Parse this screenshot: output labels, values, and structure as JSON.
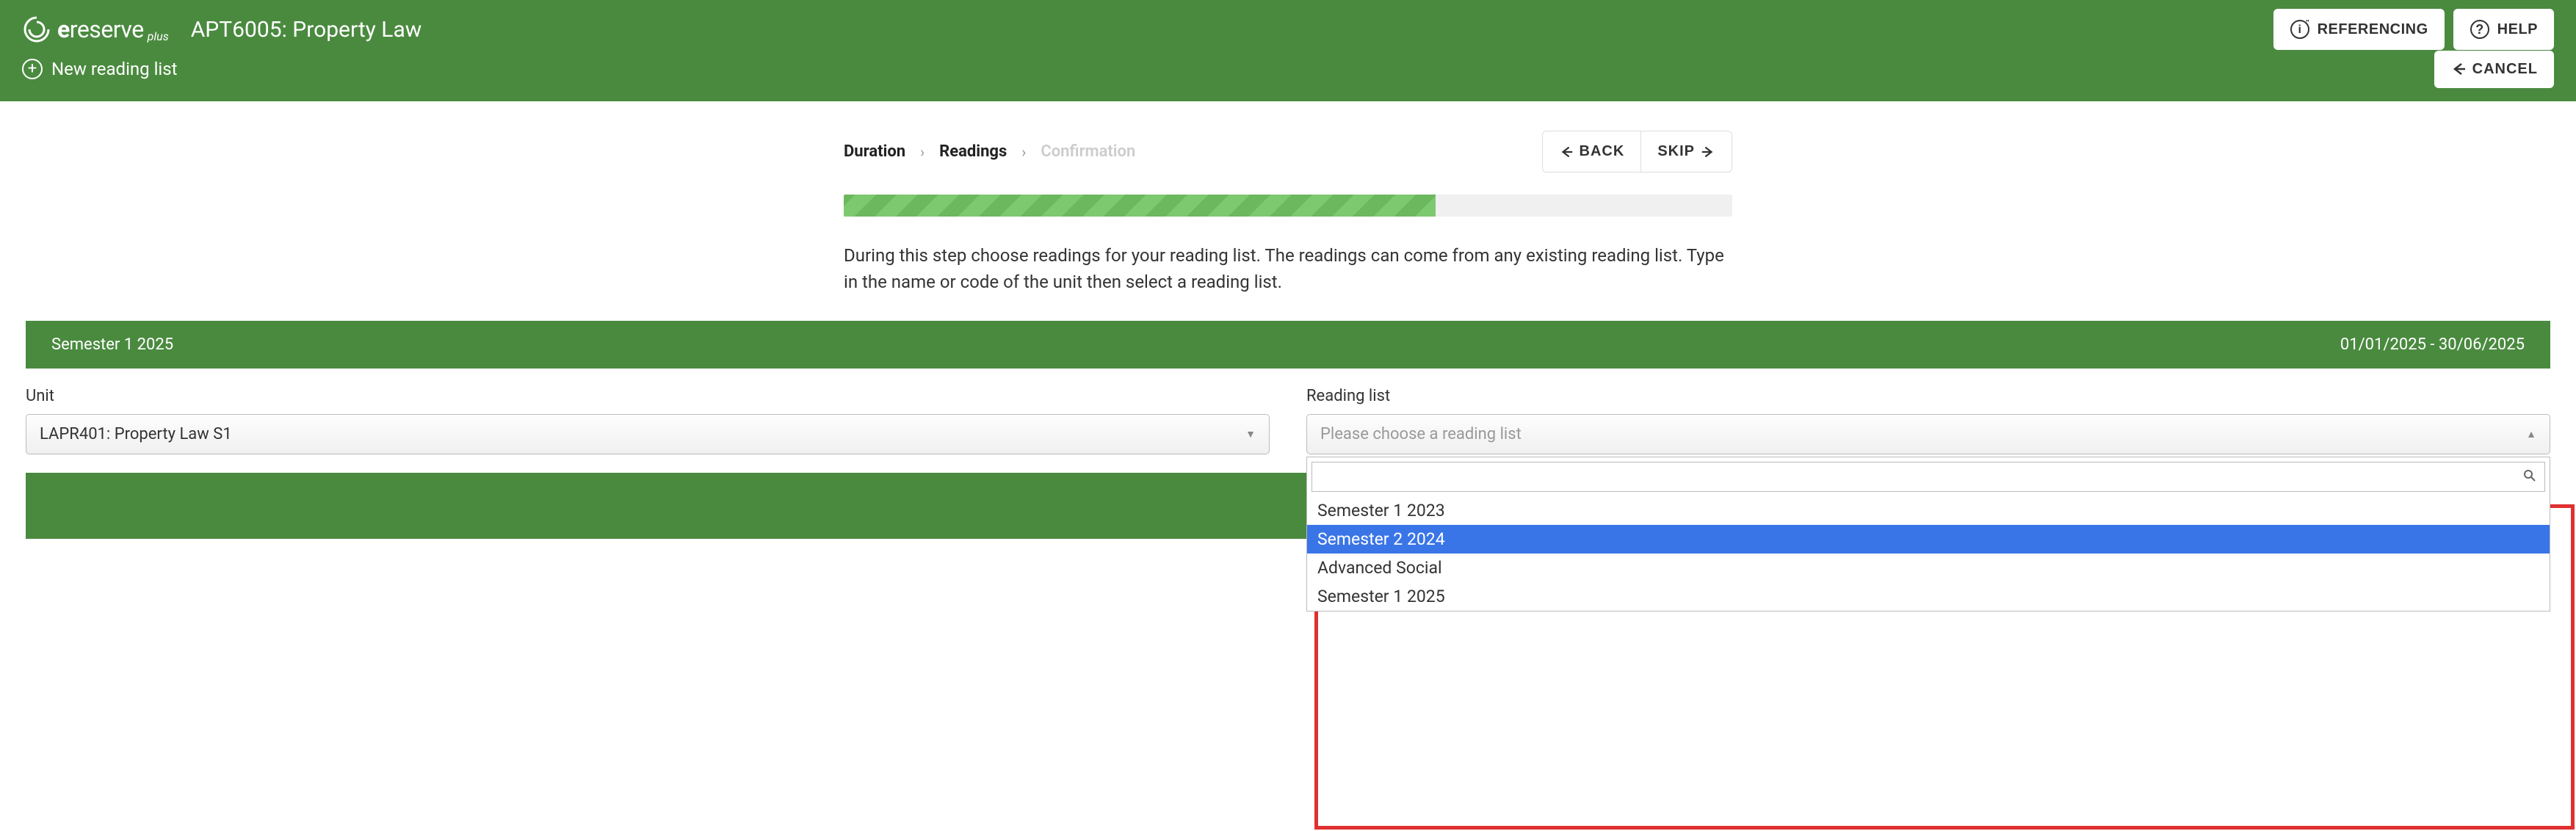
{
  "logo": {
    "brand_prefix": "e",
    "brand_main": "reserve",
    "brand_sub": "plus"
  },
  "page_title": "APT6005: Property Law",
  "header_buttons": {
    "referencing": "REFERENCING",
    "help": "HELP"
  },
  "subheader": {
    "new_list": "New reading list",
    "cancel": "CANCEL"
  },
  "breadcrumb": {
    "step1": "Duration",
    "step2": "Readings",
    "step3": "Confirmation"
  },
  "nav": {
    "back": "BACK",
    "skip": "SKIP"
  },
  "description": "During this step choose readings for your reading list. The readings can come from any existing reading list. Type in the name or code of the unit then select a reading list.",
  "semester_bar": {
    "label": "Semester 1 2025",
    "dates": "01/01/2025 - 30/06/2025"
  },
  "form": {
    "unit_label": "Unit",
    "unit_value": "LAPR401: Property Law S1",
    "reading_list_label": "Reading list",
    "reading_list_placeholder": "Please choose a reading list"
  },
  "dropdown": {
    "options": [
      "Semester 1 2023",
      "Semester 2 2024",
      "Advanced Social",
      "Semester 1 2025"
    ],
    "highlighted_index": 1
  }
}
